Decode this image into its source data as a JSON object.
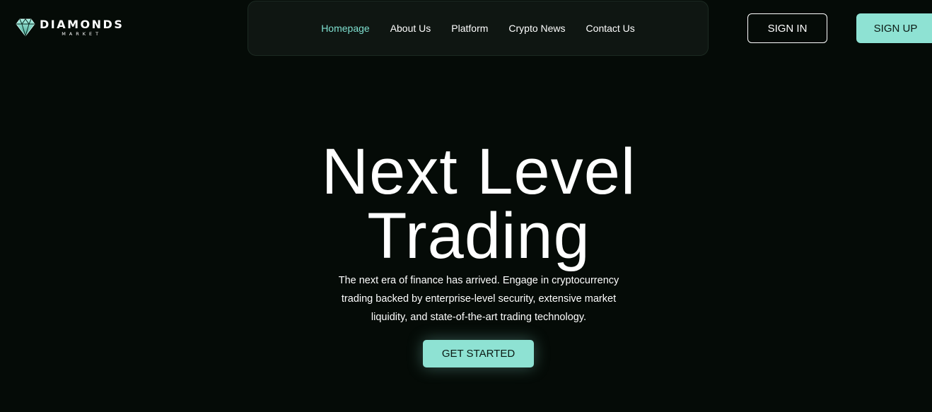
{
  "brand": {
    "name": "DIAMONDS",
    "sub": "MARKET",
    "accent_color": "#8ee2d3"
  },
  "nav": {
    "items": [
      {
        "label": "Homepage",
        "active": true
      },
      {
        "label": "About Us",
        "active": false
      },
      {
        "label": "Platform",
        "active": false
      },
      {
        "label": "Crypto News",
        "active": false
      },
      {
        "label": "Contact Us",
        "active": false
      }
    ]
  },
  "auth": {
    "sign_in_label": "SIGN IN",
    "sign_up_label": "SIGN UP"
  },
  "hero": {
    "title_line1": "Next Level",
    "title_line2": "Trading",
    "description": "The next era of finance has arrived. Engage in cryptocurrency trading backed by enterprise-level security, extensive market liquidity, and state-of-the-art trading technology.",
    "cta_label": "GET STARTED"
  },
  "icons": {
    "logo": "diamond-icon"
  }
}
